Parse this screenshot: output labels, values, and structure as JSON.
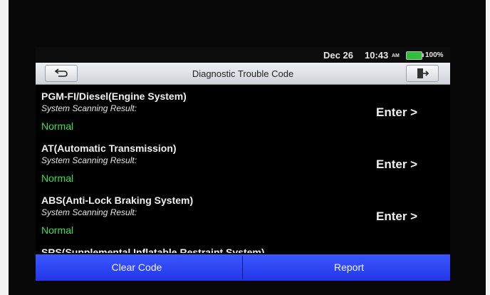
{
  "status_bar": {
    "date": "Dec 26",
    "time": "10:43",
    "ampm": "AM",
    "battery": "100%",
    "battery_color": "#2fbf3a"
  },
  "title_bar": {
    "title": "Diagnostic Trouble Code",
    "back_icon": "back-arrow-icon",
    "exit_icon": "exit-icon"
  },
  "systems": [
    {
      "name": "PGM-FI/Diesel(Engine System)",
      "result_label": "System Scanning Result:",
      "status": "Normal",
      "action": "Enter >"
    },
    {
      "name": "AT(Automatic Transmission)",
      "result_label": "System Scanning Result:",
      "status": "Normal",
      "action": "Enter >"
    },
    {
      "name": "ABS(Anti-Lock Braking System)",
      "result_label": "System Scanning Result:",
      "status": "Normal",
      "action": "Enter >"
    },
    {
      "name": "SRS(Supplemental Inflatable Restraint System)"
    }
  ],
  "bottom_bar": {
    "clear_label": "Clear Code",
    "report_label": "Report"
  },
  "colors": {
    "status_ok": "#38e04a",
    "bottom_bar": "#2f47f5"
  }
}
